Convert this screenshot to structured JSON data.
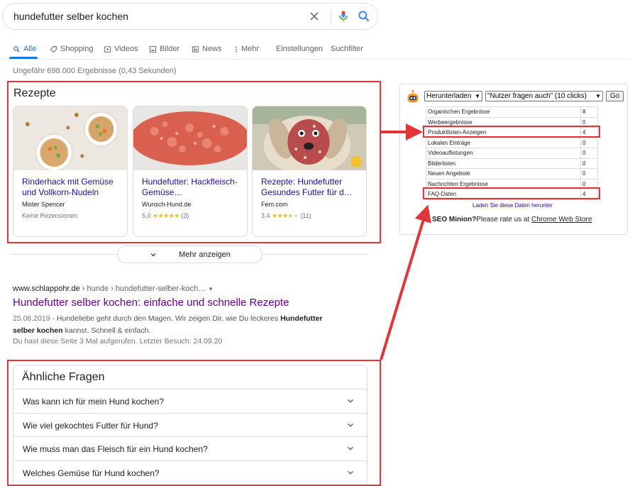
{
  "search": {
    "query": "hundefutter selber kochen"
  },
  "tabs": [
    {
      "label": "Alle",
      "icon": "search-icon"
    },
    {
      "label": "Shopping",
      "icon": "tag-icon"
    },
    {
      "label": "Videos",
      "icon": "play-icon"
    },
    {
      "label": "Bilder",
      "icon": "image-icon"
    },
    {
      "label": "News",
      "icon": "news-icon"
    },
    {
      "label": "Mehr",
      "icon": "more-vert-icon"
    },
    {
      "label": "Einstellungen"
    },
    {
      "label": "Suchfilter"
    }
  ],
  "result_stats": "Ungefähr 698.000 Ergebnisse (0,43 Sekunden)",
  "recipes": {
    "title": "Rezepte",
    "cards": [
      {
        "title": "Rinderhack mit Gemüse und Vollkorn-Nudeln",
        "source": "Mister Spencer",
        "rating_text": "Keine Rezensionen",
        "rating": null
      },
      {
        "title": "Hundefutter: Hackfleisch-Gemüse…",
        "source": "Wunsch-Hund.de",
        "rating": "5,0",
        "stars": 5,
        "count": "(3)"
      },
      {
        "title": "Rezepte: Hundefutter Gesundes Futter für d…",
        "source": "Fem.com",
        "rating": "3,4",
        "stars": 3.5,
        "count": "(11)"
      }
    ],
    "more_label": "Mehr anzeigen"
  },
  "organic": {
    "domain": "www.schlappohr.de",
    "path": " › hunde › hundefutter-selber-koch…",
    "title": "Hundefutter selber kochen: einfache und schnelle Rezepte",
    "date": "25.08.2019",
    "snippet_a": " - Hundeliebe geht durch den Magen. Wir zeigen Dir, wie Du leckeres ",
    "snippet_bold1": "Hundefutter",
    "snippet_bold2": "selber kochen",
    "snippet_b": " kannst. Schnell & einfach.",
    "visited": "Du hast diese Seite 3 Mal aufgerufen. Letzter Besuch: 24.09.20"
  },
  "paa": {
    "title": "Ähnliche Fragen",
    "questions": [
      "Was kann ich für mein Hund kochen?",
      "Wie viel gekochtes Futter für Hund?",
      "Wie muss man das Fleisch für ein Hund kochen?",
      "Welches Gemüse für Hund kochen?"
    ]
  },
  "extension": {
    "select_download": "Herunterladen",
    "select_mode": "\"Nutzer fragen auch\" (10 clicks)",
    "go_label": "Go",
    "rows": [
      {
        "label": "Organischen Ergebnisse",
        "count": "8"
      },
      {
        "label": "Werbeergebnisse",
        "count": "0"
      },
      {
        "label": "Produktlisten-Anzeigen",
        "count": "4"
      },
      {
        "label": "Lokalen Einträge",
        "count": "0"
      },
      {
        "label": "Videoauflistungen",
        "count": "0"
      },
      {
        "label": "Bilderlisten",
        "count": "0"
      },
      {
        "label": "Neuen Angebote",
        "count": "0"
      },
      {
        "label": "Nachrichten Ergebnisse",
        "count": "0"
      },
      {
        "label": "FAQ-Daten",
        "count": "4"
      }
    ],
    "download_link": "Laden Sie diese Daten herunter",
    "rate_prefix": "SEO Minion?",
    "rate_middle": "Please rate us at ",
    "rate_link": "Chrome Web Store"
  },
  "colors": {
    "annotation_red": "#e0363b",
    "link_blue": "#1a0dab",
    "visited_purple": "#660099",
    "accent": "#1a73e8"
  }
}
